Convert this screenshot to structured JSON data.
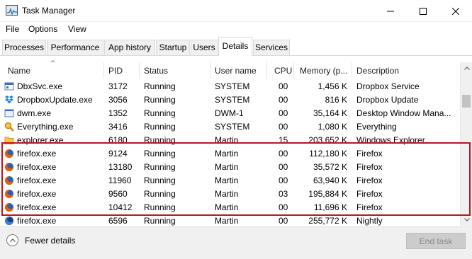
{
  "window": {
    "title": "Task Manager",
    "app_icon": "task-manager-icon"
  },
  "window_controls": {
    "minimize_icon": "minimize-icon",
    "maximize_icon": "maximize-icon",
    "close_icon": "close-icon"
  },
  "menu": {
    "file": "File",
    "options": "Options",
    "view": "View"
  },
  "tabs": [
    {
      "label": "Processes"
    },
    {
      "label": "Performance"
    },
    {
      "label": "App history"
    },
    {
      "label": "Startup"
    },
    {
      "label": "Users"
    },
    {
      "label": "Details",
      "active": true
    },
    {
      "label": "Services"
    }
  ],
  "columns": {
    "name": "Name",
    "pid": "PID",
    "status": "Status",
    "user": "User name",
    "cpu": "CPU",
    "memory": "Memory (p...",
    "description": "Description"
  },
  "rows": [
    {
      "icon": "service-icon",
      "name": "DbxSvc.exe",
      "pid": "3172",
      "status": "Running",
      "user": "SYSTEM",
      "cpu": "00",
      "memory": "1,456 K",
      "description": "Dropbox Service"
    },
    {
      "icon": "dropbox-icon",
      "name": "DropboxUpdate.exe",
      "pid": "3056",
      "status": "Running",
      "user": "SYSTEM",
      "cpu": "00",
      "memory": "816 K",
      "description": "Dropbox Update"
    },
    {
      "icon": "window-manager-icon",
      "name": "dwm.exe",
      "pid": "1352",
      "status": "Running",
      "user": "DWM-1",
      "cpu": "00",
      "memory": "35,164 K",
      "description": "Desktop Window Mana..."
    },
    {
      "icon": "everything-search-icon",
      "name": "Everything.exe",
      "pid": "3416",
      "status": "Running",
      "user": "SYSTEM",
      "cpu": "00",
      "memory": "1,080 K",
      "description": "Everything"
    },
    {
      "icon": "folder-icon",
      "name": "explorer.exe",
      "pid": "6180",
      "status": "Running",
      "user": "Martin",
      "cpu": "15",
      "memory": "203,652 K",
      "description": "Windows Explorer"
    },
    {
      "icon": "firefox-icon",
      "name": "firefox.exe",
      "pid": "9124",
      "status": "Running",
      "user": "Martin",
      "cpu": "00",
      "memory": "112,180 K",
      "description": "Firefox"
    },
    {
      "icon": "firefox-icon",
      "name": "firefox.exe",
      "pid": "13180",
      "status": "Running",
      "user": "Martin",
      "cpu": "00",
      "memory": "35,572 K",
      "description": "Firefox"
    },
    {
      "icon": "firefox-icon",
      "name": "firefox.exe",
      "pid": "11960",
      "status": "Running",
      "user": "Martin",
      "cpu": "00",
      "memory": "63,940 K",
      "description": "Firefox"
    },
    {
      "icon": "firefox-icon",
      "name": "firefox.exe",
      "pid": "9560",
      "status": "Running",
      "user": "Martin",
      "cpu": "03",
      "memory": "195,884 K",
      "description": "Firefox"
    },
    {
      "icon": "firefox-icon",
      "name": "firefox.exe",
      "pid": "10412",
      "status": "Running",
      "user": "Martin",
      "cpu": "00",
      "memory": "11,696 K",
      "description": "Firefox"
    },
    {
      "icon": "nightly-icon",
      "name": "firefox.exe",
      "pid": "6596",
      "status": "Running",
      "user": "Martin",
      "cpu": "00",
      "memory": "255,772 K",
      "description": "Nightly"
    }
  ],
  "footer": {
    "fewer_details": "Fewer details",
    "fewer_icon": "chevron-up-icon",
    "end_task": "End task"
  },
  "colors": {
    "highlight": "#c0141e",
    "firefox": "#e66000"
  }
}
